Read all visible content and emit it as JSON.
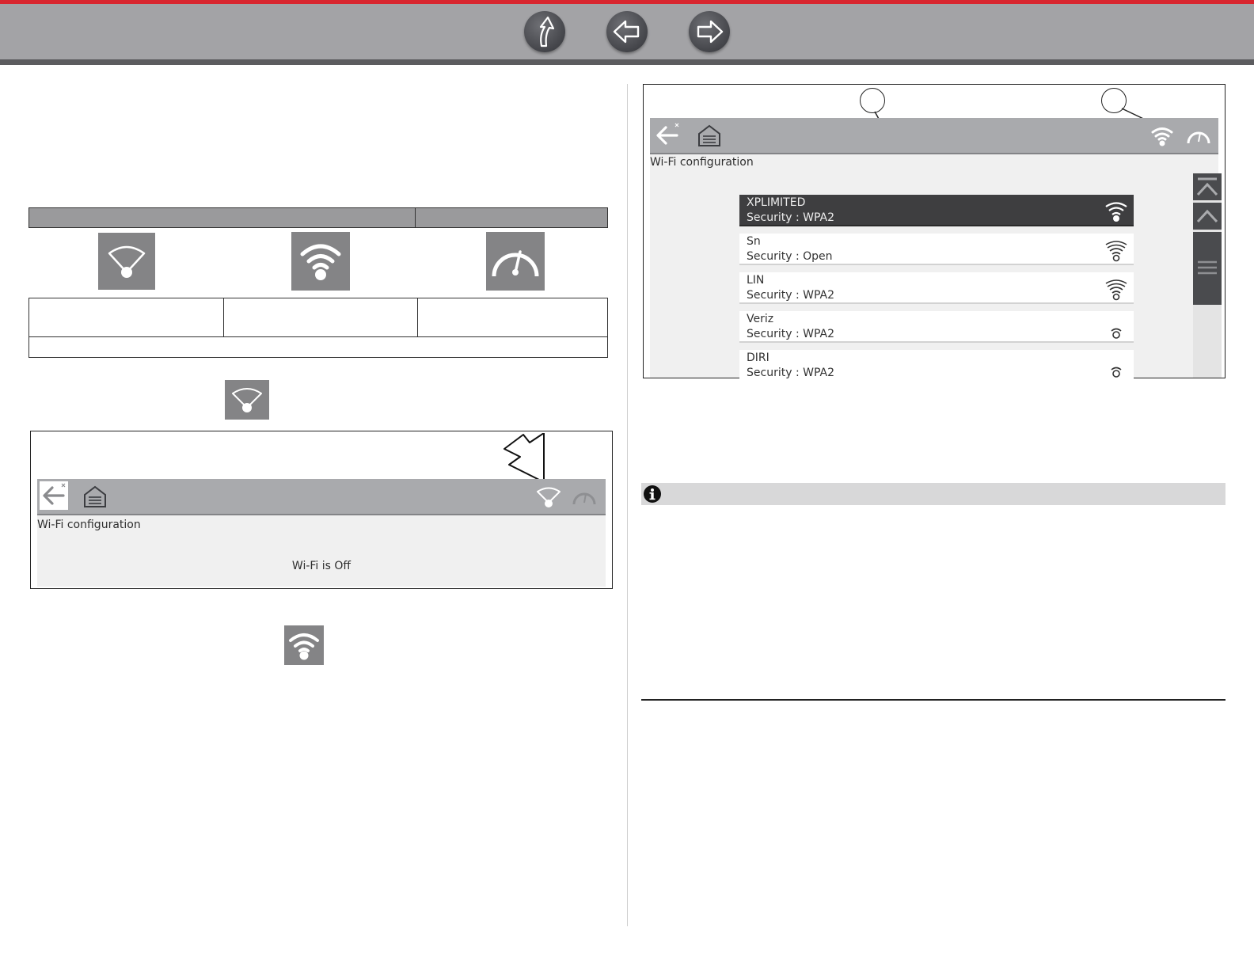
{
  "nav": {
    "buttons": [
      {
        "name": "up",
        "icon": "up-arrow-icon"
      },
      {
        "name": "back",
        "icon": "left-arrow-icon"
      },
      {
        "name": "forward",
        "icon": "right-arrow-icon"
      }
    ],
    "accent_color": "#d9262f"
  },
  "status_table": {
    "icons": [
      "wifi-off-icon",
      "wifi-connected-icon",
      "data-meter-icon"
    ]
  },
  "wifi_off_screen": {
    "title": "Wi-Fi configuration",
    "message": "Wi-Fi is Off"
  },
  "wifi_list_screen": {
    "title": "Wi-Fi configuration",
    "networks": [
      {
        "name": "XPLIMITED",
        "security": "Security : WPA2",
        "selected": true,
        "signal": 4
      },
      {
        "name": "Sn",
        "security": "Security : Open",
        "selected": false,
        "signal": 4
      },
      {
        "name": "LIN",
        "security": "Security : WPA2",
        "selected": false,
        "signal": 4
      },
      {
        "name": "Veriz",
        "security": "Security : WPA2",
        "selected": false,
        "signal": 1
      },
      {
        "name": "DIRI",
        "security": "Security : WPA2",
        "selected": false,
        "signal": 1
      }
    ]
  },
  "note": {
    "icon": "info-icon"
  }
}
